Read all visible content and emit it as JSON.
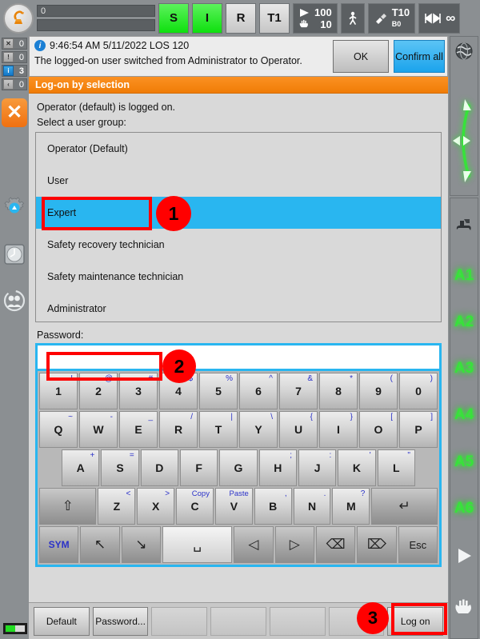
{
  "statusbar": {
    "robot_icon": "kuka-robot-logo",
    "slider_value": "0",
    "buttons": [
      {
        "label": "S",
        "state": "green",
        "name": "drives-ready-indicator"
      },
      {
        "label": "I",
        "state": "green",
        "name": "interpreter-indicator"
      },
      {
        "label": "R",
        "state": "grey",
        "name": "robot-indicator"
      },
      {
        "label": "T1",
        "state": "grey",
        "name": "operating-mode-indicator"
      }
    ],
    "program_override": "100",
    "jog_override": "10",
    "tool_label": "T10",
    "base_label": "B0",
    "increment": "∞"
  },
  "left_sidebar": {
    "message_counts": [
      {
        "icon": "acknowledge-message-icon",
        "count": "0",
        "active": false
      },
      {
        "icon": "warning-message-icon",
        "count": "0",
        "active": false
      },
      {
        "icon": "info-message-icon",
        "count": "3",
        "active": true
      },
      {
        "icon": "wait-message-icon",
        "count": "0",
        "active": false
      }
    ],
    "close_label": "✕",
    "icons": [
      "gear-icon",
      "clock-icon",
      "user-icon"
    ]
  },
  "right_sidebar": {
    "icons": [
      "globe-icon",
      "jog-arrows-icon",
      "tool-icon",
      "play-icon",
      "hand-icon"
    ],
    "axes": [
      "A1",
      "A2",
      "A3",
      "A4",
      "A5",
      "A6"
    ]
  },
  "message": {
    "info_icon": "info-icon",
    "header": "9:46:54 AM 5/11/2022 LOS 120",
    "body": "The logged-on user switched from Administrator to Operator.",
    "ok_label": "OK",
    "confirm_all_label": "Confirm all"
  },
  "window": {
    "title": "Log-on by selection",
    "status_text": "Operator (default) is logged on.",
    "select_label": "Select a user group:",
    "user_groups": [
      {
        "label": "Operator (Default)",
        "selected": false
      },
      {
        "label": "User",
        "selected": false
      },
      {
        "label": "Expert",
        "selected": true
      },
      {
        "label": "Safety recovery technician",
        "selected": false
      },
      {
        "label": "Safety maintenance technician",
        "selected": false
      },
      {
        "label": "Administrator",
        "selected": false
      }
    ],
    "password_label": "Password:",
    "password_value": "",
    "password_placeholder": ""
  },
  "keyboard": {
    "rows": [
      [
        {
          "main": "1",
          "alt": "!"
        },
        {
          "main": "2",
          "alt": "@"
        },
        {
          "main": "3",
          "alt": "#"
        },
        {
          "main": "4",
          "alt": "$"
        },
        {
          "main": "5",
          "alt": "%"
        },
        {
          "main": "6",
          "alt": "^"
        },
        {
          "main": "7",
          "alt": "&"
        },
        {
          "main": "8",
          "alt": "*"
        },
        {
          "main": "9",
          "alt": "("
        },
        {
          "main": "0",
          "alt": ")"
        }
      ],
      [
        {
          "main": "Q",
          "alt": "~"
        },
        {
          "main": "W",
          "alt": "-"
        },
        {
          "main": "E",
          "alt": "_"
        },
        {
          "main": "R",
          "alt": "/"
        },
        {
          "main": "T",
          "alt": "|"
        },
        {
          "main": "Y",
          "alt": "\\"
        },
        {
          "main": "U",
          "alt": "{"
        },
        {
          "main": "I",
          "alt": "}"
        },
        {
          "main": "O",
          "alt": "["
        },
        {
          "main": "P",
          "alt": "]"
        }
      ],
      [
        {
          "main": "A",
          "alt": "+"
        },
        {
          "main": "S",
          "alt": "="
        },
        {
          "main": "D",
          "alt": ""
        },
        {
          "main": "F",
          "alt": ""
        },
        {
          "main": "G",
          "alt": ""
        },
        {
          "main": "H",
          "alt": ";"
        },
        {
          "main": "J",
          "alt": ":"
        },
        {
          "main": "K",
          "alt": "'"
        },
        {
          "main": "L",
          "alt": "\""
        }
      ],
      [
        {
          "main": "⇧",
          "alt": "",
          "icon": "shift-key",
          "dark": true
        },
        {
          "main": "Z",
          "alt": "<"
        },
        {
          "main": "X",
          "alt": ">"
        },
        {
          "main": "C",
          "alt": "Copy",
          "altword": true
        },
        {
          "main": "V",
          "alt": "Paste",
          "altword": true
        },
        {
          "main": "B",
          "alt": ","
        },
        {
          "main": "N",
          "alt": "."
        },
        {
          "main": "M",
          "alt": "?"
        },
        {
          "main": "↵",
          "alt": "",
          "icon": "enter-key",
          "dark": true
        }
      ],
      [
        {
          "main": "SYM",
          "alt": "",
          "icon": "symbol-key",
          "dark": true,
          "blue": true
        },
        {
          "main": "↖",
          "alt": "",
          "icon": "home-key",
          "dark": true
        },
        {
          "main": "↘",
          "alt": "",
          "icon": "end-key",
          "dark": true
        },
        {
          "main": "␣",
          "alt": "",
          "icon": "space-key",
          "space": true
        },
        {
          "main": "◁",
          "alt": "",
          "icon": "arrow-left-key",
          "dark": true
        },
        {
          "main": "▷",
          "alt": "",
          "icon": "arrow-right-key",
          "dark": true
        },
        {
          "main": "⌫",
          "alt": "",
          "icon": "backspace-key",
          "dark": true
        },
        {
          "main": "⌦",
          "alt": "",
          "icon": "delete-key",
          "dark": true
        },
        {
          "main": "Esc",
          "alt": "",
          "icon": "escape-key",
          "dark": true
        }
      ]
    ]
  },
  "footer": {
    "buttons": [
      {
        "label": "Default",
        "empty": false
      },
      {
        "label": "Password...",
        "empty": false
      },
      {
        "label": "",
        "empty": true
      },
      {
        "label": "",
        "empty": true
      },
      {
        "label": "",
        "empty": true
      },
      {
        "label": "",
        "empty": true
      },
      {
        "label": "Log on",
        "empty": false
      }
    ]
  },
  "annotations": [
    {
      "number": "1",
      "target": "expert-list-item"
    },
    {
      "number": "2",
      "target": "password-input"
    },
    {
      "number": "3",
      "target": "log-on-button"
    }
  ],
  "colors": {
    "accent_orange": "#f07c06",
    "highlight_blue": "#29b6f0",
    "annotation_red": "#ff0000",
    "axis_green": "#37e23a"
  }
}
